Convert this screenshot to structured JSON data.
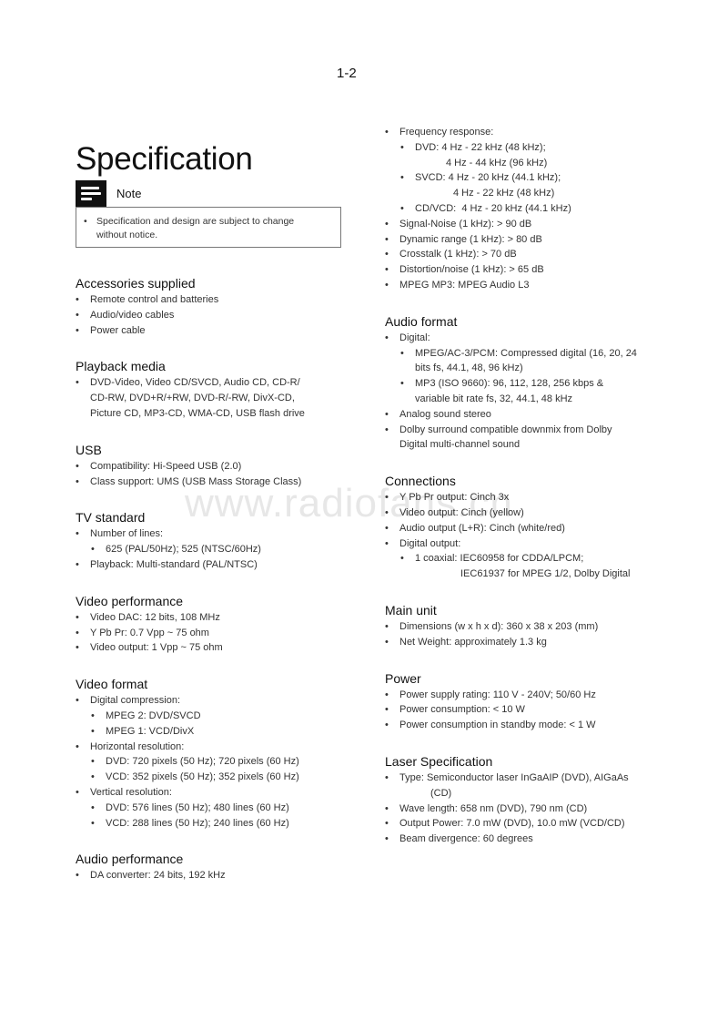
{
  "page_number": "1-2",
  "title": "Specification",
  "note": {
    "icon": "note-icon",
    "label": "Note",
    "items": [
      "Specification and design are subject to change without notice."
    ],
    "line1": "Specification and design are subject to change",
    "line2": "without notice."
  },
  "watermark": "www.radiofans.cn",
  "left_sections": [
    {
      "heading": "Accessories supplied",
      "items": [
        "Remote control and batteries",
        "Audio/video cables",
        "Power cable"
      ]
    },
    {
      "heading": "Playback media",
      "lines": [
        "DVD-Video, Video CD/SVCD, Audio CD, CD-R/",
        "CD-RW, DVD+R/+RW, DVD-R/-RW, DivX-CD,",
        "Picture CD, MP3-CD, WMA-CD, USB flash drive"
      ]
    },
    {
      "heading": "USB",
      "items": [
        "Compatibility: Hi-Speed USB (2.0)",
        "Class support: UMS (USB Mass Storage Class)"
      ]
    },
    {
      "heading": "TV standard",
      "items": [
        "Number of lines:",
        "625 (PAL/50Hz); 525 (NTSC/60Hz)",
        "Playback: Multi-standard (PAL/NTSC)"
      ]
    },
    {
      "heading": "Video performance",
      "items": [
        "Video DAC: 12 bits, 108 MHz",
        "Y Pb Pr: 0.7 Vpp ~ 75 ohm",
        "Video output: 1 Vpp ~ 75 ohm"
      ]
    },
    {
      "heading": "Video format",
      "items": [
        "Digital compression:",
        "MPEG 2: DVD/SVCD",
        "MPEG 1: VCD/DivX",
        "Horizontal resolution:",
        "DVD: 720 pixels (50 Hz); 720 pixels (60 Hz)",
        "VCD: 352 pixels (50 Hz); 352 pixels (60 Hz)",
        "Vertical resolution:",
        "DVD: 576 lines (50 Hz); 480 lines (60 Hz)",
        "VCD: 288 lines (50 Hz); 240 lines (60 Hz)"
      ]
    },
    {
      "heading": "Audio performance",
      "items": [
        "DA converter: 24 bits, 192 kHz"
      ]
    }
  ],
  "right_sections": [
    {
      "items": [
        "Frequency response:",
        "DVD: 4 Hz - 22 kHz (48 kHz);",
        "4 Hz - 44 kHz (96 kHz)",
        "SVCD: 4 Hz - 20 kHz (44.1 kHz);",
        "4 Hz - 22 kHz (48 kHz)",
        "CD/VCD:  4 Hz - 20 kHz (44.1 kHz)",
        "Signal-Noise (1 kHz): > 90 dB",
        "Dynamic range (1 kHz): > 80 dB",
        "Crosstalk (1 kHz): > 70 dB",
        "Distortion/noise (1 kHz): > 65 dB",
        "MPEG MP3: MPEG Audio L3"
      ]
    },
    {
      "heading": "Audio format",
      "items": [
        "Digital:",
        "MPEG/AC-3/PCM: Compressed digital (16, 20, 24",
        "bits fs, 44.1, 48, 96 kHz)",
        "MP3 (ISO 9660): 96, 112, 128, 256 kbps &",
        "variable bit rate fs, 32, 44.1, 48 kHz",
        "Analog sound stereo",
        "Dolby surround compatible downmix from Dolby",
        "Digital multi-channel sound"
      ]
    },
    {
      "heading": "Connections",
      "items": [
        "Y Pb Pr output: Cinch 3x",
        "Video output: Cinch (yellow)",
        "Audio output (L+R): Cinch (white/red)",
        "Digital output:",
        "1 coaxial: IEC60958 for CDDA/LPCM;",
        "IEC61937 for MPEG 1/2, Dolby Digital"
      ]
    },
    {
      "heading": "Main unit",
      "items": [
        "Dimensions (w x h x d): 360 x 38 x 203 (mm)",
        "Net Weight: approximately 1.3 kg"
      ]
    },
    {
      "heading": "Power",
      "items": [
        "Power supply rating: 110 V - 240V; 50/60 Hz",
        "Power consumption: < 10 W",
        "Power consumption in standby mode: < 1 W"
      ]
    },
    {
      "heading": "Laser Specification",
      "items": [
        "Type: Semiconductor laser InGaAIP (DVD), AIGaAs",
        "(CD)",
        "Wave length: 658 nm (DVD), 790 nm (CD)",
        "Output Power: 7.0 mW (DVD), 10.0 mW (VCD/CD)",
        "Beam divergence: 60 degrees"
      ]
    }
  ]
}
